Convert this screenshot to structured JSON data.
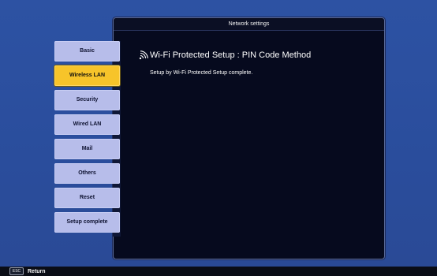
{
  "window": {
    "title": "Network settings"
  },
  "sidebar": {
    "items": [
      {
        "label": "Basic",
        "active": false
      },
      {
        "label": "Wireless LAN",
        "active": true
      },
      {
        "label": "Security",
        "active": false
      },
      {
        "label": "Wired LAN",
        "active": false
      },
      {
        "label": "Mail",
        "active": false
      },
      {
        "label": "Others",
        "active": false
      },
      {
        "label": "Reset",
        "active": false
      },
      {
        "label": "Setup complete",
        "active": false
      }
    ]
  },
  "content": {
    "heading": "Wi-Fi Protected Setup : PIN Code Method",
    "heading_icon": "wifi-signal-icon",
    "message": "Setup by Wi-Fi Protected Setup complete."
  },
  "statusbar": {
    "key_label": "ESC",
    "action_label": "Return"
  },
  "colors": {
    "background": "#2b4f9c",
    "panel": "#060a1e",
    "nav_item": "#b7bdea",
    "nav_active": "#f7c42a"
  }
}
